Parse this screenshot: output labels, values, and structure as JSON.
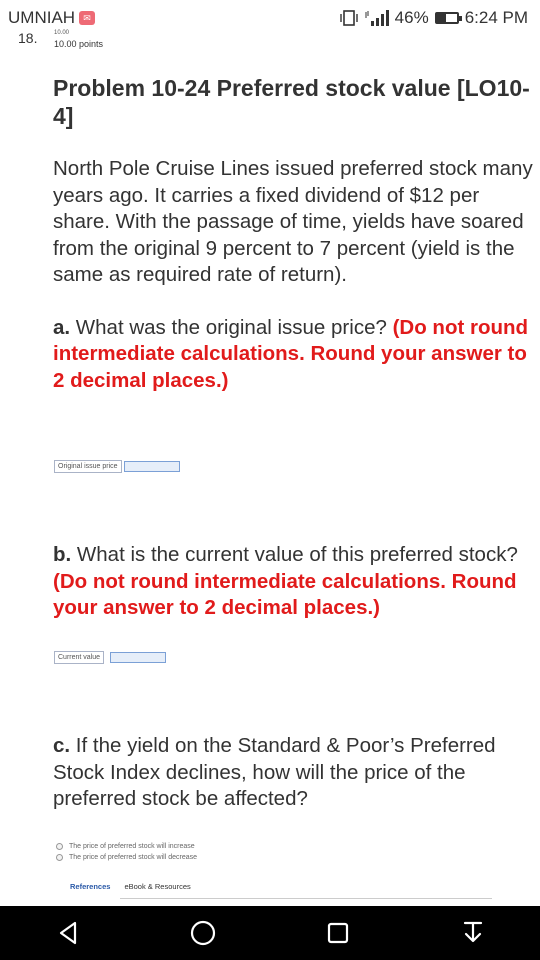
{
  "status_bar": {
    "carrier": "UMNIAH",
    "carrier_badge": "✉",
    "signal_text": "46%",
    "time": "6:24 PM",
    "battery_level": 0.46
  },
  "question_header": {
    "number": "18.",
    "meta": "10.00",
    "points": "10.00 points"
  },
  "problem": {
    "title": "Problem 10-24 Preferred stock value [LO10-4]",
    "intro": "North Pole Cruise Lines issued preferred stock many years ago. It carries a fixed dividend of $12 per share. With the passage of time, yields have soared from the original 9 percent to 7 percent (yield is the same as required rate of return).",
    "part_a": {
      "letter": "a.",
      "question": " What was the original issue price? ",
      "instruction": "(Do not round intermediate calculations. Round your answer to 2 decimal places.)",
      "field_label": "Original issue price",
      "field_value": ""
    },
    "part_b": {
      "letter": "b.",
      "question": " What is the current value of this preferred stock? ",
      "instruction": "(Do not round intermediate calculations. Round your answer to 2 decimal places.)",
      "field_label": "Current value",
      "field_value": ""
    },
    "part_c": {
      "letter": "c.",
      "question": " If the yield on the Standard & Poor’s Preferred Stock Index declines, how will the price of the preferred stock be affected?",
      "options": [
        "The price of preferred stock will increase",
        "The price of preferred stock will decrease"
      ]
    }
  },
  "references": {
    "references_label": "References",
    "ebook_label": "eBook & Resources"
  },
  "nav": {
    "icons": [
      "back-icon",
      "home-icon",
      "recents-icon",
      "notification-pull-icon"
    ]
  }
}
